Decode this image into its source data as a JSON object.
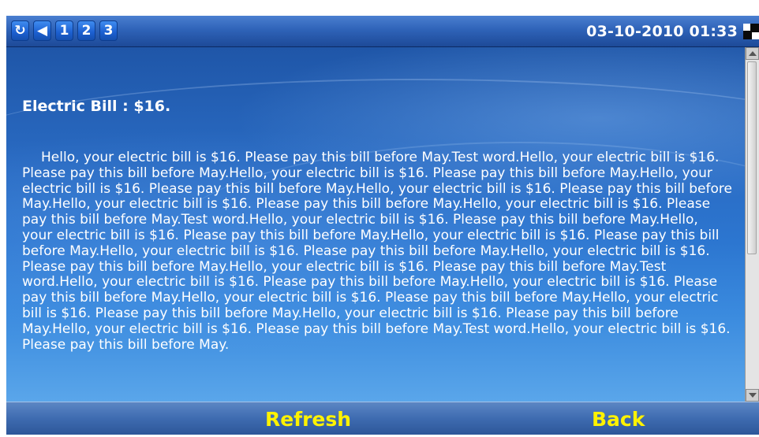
{
  "status_bar": {
    "icons": [
      {
        "name": "sync-icon",
        "glyph": "↻"
      },
      {
        "name": "speaker-icon",
        "glyph": "◀"
      },
      {
        "name": "account-1-icon",
        "glyph": "1"
      },
      {
        "name": "account-2-icon",
        "glyph": "2"
      },
      {
        "name": "account-3-icon",
        "glyph": "3"
      }
    ],
    "datetime": "03-10-2010 01:33",
    "grid_icon": "grid-icon"
  },
  "message": {
    "title": "Electric Bill : $16.",
    "body": "Hello, your electric bill is $16. Please pay this bill before May.Test word.Hello, your electric bill is $16. Please pay this bill before May.Hello, your electric bill is $16. Please pay this bill before May.Hello, your electric bill is $16. Please pay this bill before May.Hello, your electric bill is $16. Please pay this bill before May.Hello, your electric bill is $16. Please pay this bill before May.Hello, your electric bill is $16. Please pay this bill before May.Test word.Hello, your electric bill is $16. Please pay this bill before May.Hello, your electric bill is $16. Please pay this bill before May.Hello, your electric bill is $16. Please pay this bill before May.Hello, your electric bill is $16. Please pay this bill before May.Hello, your electric bill is $16. Please pay this bill before May.Hello, your electric bill is $16. Please pay this bill before May.Test word.Hello, your electric bill is $16. Please pay this bill before May.Hello, your electric bill is $16. Please pay this bill before May.Hello, your electric bill is $16. Please pay this bill before May.Hello, your electric bill is $16. Please pay this bill before May.Hello, your electric bill is $16. Please pay this bill before May.Hello, your electric bill is $16. Please pay this bill before May.Test word.Hello, your electric bill is $16. Please pay this bill before May."
  },
  "softkeys": {
    "refresh": "Refresh",
    "back": "Back"
  },
  "colors": {
    "softkey_text": "#fff200",
    "status_bar": "#2f63b8",
    "content_background": "#2a6cc4"
  }
}
